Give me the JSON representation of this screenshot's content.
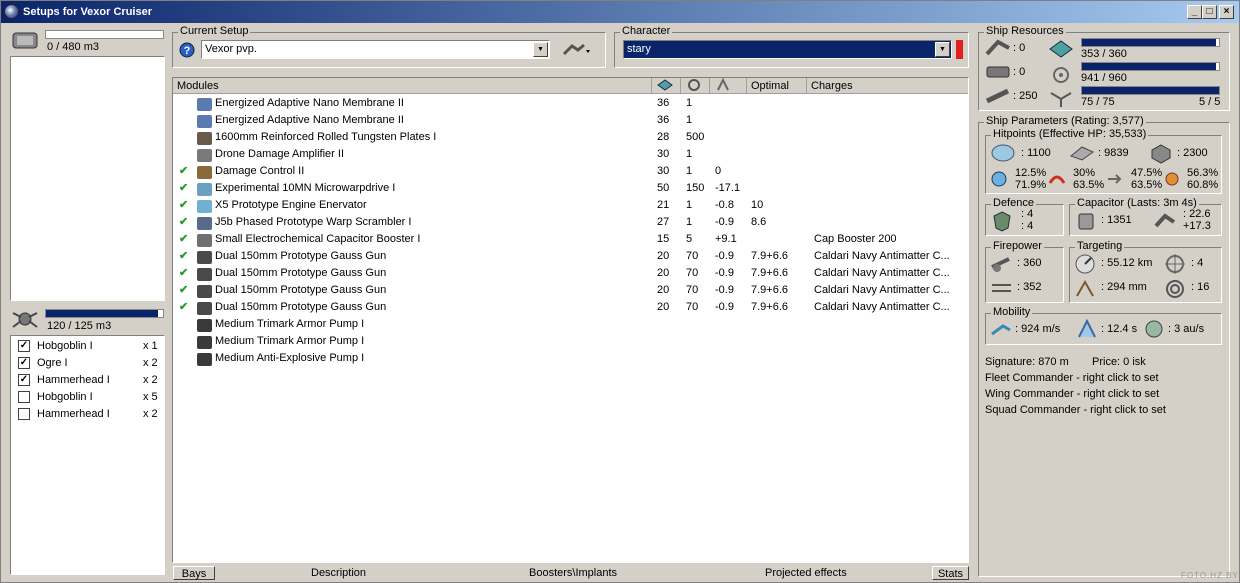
{
  "window": {
    "title": "Setups for Vexor Cruiser"
  },
  "cargo": {
    "volume": "0 / 480 m3",
    "fill": 0.0
  },
  "drone_bay": {
    "volume": "120 / 125 m3",
    "fill": 0.96,
    "items": [
      {
        "checked": true,
        "name": "Hobgoblin I",
        "qty": "x 1"
      },
      {
        "checked": true,
        "name": "Ogre I",
        "qty": "x 2"
      },
      {
        "checked": true,
        "name": "Hammerhead I",
        "qty": "x 2"
      },
      {
        "checked": false,
        "name": "Hobgoblin I",
        "qty": "x 5"
      },
      {
        "checked": false,
        "name": "Hammerhead I",
        "qty": "x 2"
      }
    ]
  },
  "setup": {
    "label": "Current Setup",
    "value": "Vexor pvp."
  },
  "character": {
    "label": "Character",
    "value": "stary"
  },
  "modules": {
    "columns": {
      "name": "Modules",
      "optimal": "Optimal",
      "charges": "Charges"
    },
    "rows": [
      {
        "ok": false,
        "name": "Energized Adaptive Nano Membrane II",
        "c1": "36",
        "c2": "1",
        "c3": "",
        "optimal": "",
        "charges": "",
        "color": "#5a7ab0"
      },
      {
        "ok": false,
        "name": "Energized Adaptive Nano Membrane II",
        "c1": "36",
        "c2": "1",
        "c3": "",
        "optimal": "",
        "charges": "",
        "color": "#5a7ab0"
      },
      {
        "ok": false,
        "name": "1600mm Reinforced Rolled Tungsten Plates I",
        "c1": "28",
        "c2": "500",
        "c3": "",
        "optimal": "",
        "charges": "",
        "color": "#6a5a4a"
      },
      {
        "ok": false,
        "name": "Drone Damage Amplifier II",
        "c1": "30",
        "c2": "1",
        "c3": "",
        "optimal": "",
        "charges": "",
        "color": "#7a7a7a"
      },
      {
        "ok": true,
        "name": "Damage Control II",
        "c1": "30",
        "c2": "1",
        "c3": "0",
        "optimal": "",
        "charges": "",
        "color": "#8a6a3a"
      },
      {
        "ok": true,
        "name": "Experimental 10MN Microwarpdrive I",
        "c1": "50",
        "c2": "150",
        "c3": "-17.1",
        "optimal": "",
        "charges": "",
        "color": "#6aa0c0"
      },
      {
        "ok": true,
        "name": "X5 Prototype Engine Enervator",
        "c1": "21",
        "c2": "1",
        "c3": "-0.8",
        "optimal": "10",
        "charges": "",
        "color": "#70b0d0"
      },
      {
        "ok": true,
        "name": "J5b Phased Prototype Warp Scrambler I",
        "c1": "27",
        "c2": "1",
        "c3": "-0.9",
        "optimal": "8.6",
        "charges": "",
        "color": "#5a6a8a"
      },
      {
        "ok": true,
        "name": "Small Electrochemical Capacitor Booster I",
        "c1": "15",
        "c2": "5",
        "c3": "+9.1",
        "optimal": "",
        "charges": "Cap Booster 200",
        "color": "#707070"
      },
      {
        "ok": true,
        "name": "Dual 150mm Prototype Gauss Gun",
        "c1": "20",
        "c2": "70",
        "c3": "-0.9",
        "optimal": "7.9+6.6",
        "charges": "Caldari Navy Antimatter C...",
        "color": "#4a4a4a"
      },
      {
        "ok": true,
        "name": "Dual 150mm Prototype Gauss Gun",
        "c1": "20",
        "c2": "70",
        "c3": "-0.9",
        "optimal": "7.9+6.6",
        "charges": "Caldari Navy Antimatter C...",
        "color": "#4a4a4a"
      },
      {
        "ok": true,
        "name": "Dual 150mm Prototype Gauss Gun",
        "c1": "20",
        "c2": "70",
        "c3": "-0.9",
        "optimal": "7.9+6.6",
        "charges": "Caldari Navy Antimatter C...",
        "color": "#4a4a4a"
      },
      {
        "ok": true,
        "name": "Dual 150mm Prototype Gauss Gun",
        "c1": "20",
        "c2": "70",
        "c3": "-0.9",
        "optimal": "7.9+6.6",
        "charges": "Caldari Navy Antimatter C...",
        "color": "#4a4a4a"
      },
      {
        "ok": false,
        "name": "Medium Trimark Armor Pump I",
        "c1": "",
        "c2": "",
        "c3": "",
        "optimal": "",
        "charges": "",
        "color": "#3a3a3a"
      },
      {
        "ok": false,
        "name": "Medium Trimark Armor Pump I",
        "c1": "",
        "c2": "",
        "c3": "",
        "optimal": "",
        "charges": "",
        "color": "#3a3a3a"
      },
      {
        "ok": false,
        "name": "Medium Anti-Explosive Pump I",
        "c1": "",
        "c2": "",
        "c3": "",
        "optimal": "",
        "charges": "",
        "color": "#3a3a3a"
      }
    ]
  },
  "tabs": {
    "bays": "Bays",
    "description": "Description",
    "boosters": "Boosters\\Implants",
    "projected": "Projected effects",
    "stats": "Stats"
  },
  "resources": {
    "label": "Ship Resources",
    "hi": ": 0",
    "med": ": 0",
    "calib": ": 250",
    "cpu": "353 / 360",
    "cpu_fill": 0.98,
    "pg": "941 / 960",
    "pg_fill": 0.98,
    "bandwidth": "75 / 75",
    "bandwidth_fill": 1.0,
    "drones": "5 / 5"
  },
  "params": {
    "label": "Ship Parameters (Rating: 3,577)",
    "hp_label": "Hitpoints (Effective HP: 35,533)",
    "shield_hp": ": 1100",
    "armor_hp": ": 9839",
    "hull_hp": ": 2300",
    "em_a": "12.5%",
    "em_b": "71.9%",
    "th_a": "30%",
    "th_b": "63.5%",
    "ki_a": "47.5%",
    "ki_b": "63.5%",
    "ex_a": "56.3%",
    "ex_b": "60.8%",
    "defence_label": "Defence",
    "def_a": ": 4",
    "def_b": ": 4",
    "cap_label": "Capacitor (Lasts: 3m 4s)",
    "cap_amount": ": 1351",
    "cap_a": ": 22.6",
    "cap_b": "+17.3",
    "fire_label": "Firepower",
    "fire_a": ": 360",
    "fire_b": ": 352",
    "targ_label": "Targeting",
    "targ_range": ": 55.12 km",
    "targ_res": ": 294 mm",
    "targ_max": ": 4",
    "targ_sensor": ": 16",
    "mob_label": "Mobility",
    "mob_speed": ": 924 m/s",
    "mob_align": ": 12.4 s",
    "mob_warp": ": 3 au/s",
    "signature": "Signature: 870 m",
    "price": "Price: 0 isk",
    "fleet": "Fleet Commander - right click to set",
    "wing": "Wing Commander - right click to set",
    "squad": "Squad Commander - right click to set"
  },
  "watermark": "FOTO.HZ.BY"
}
